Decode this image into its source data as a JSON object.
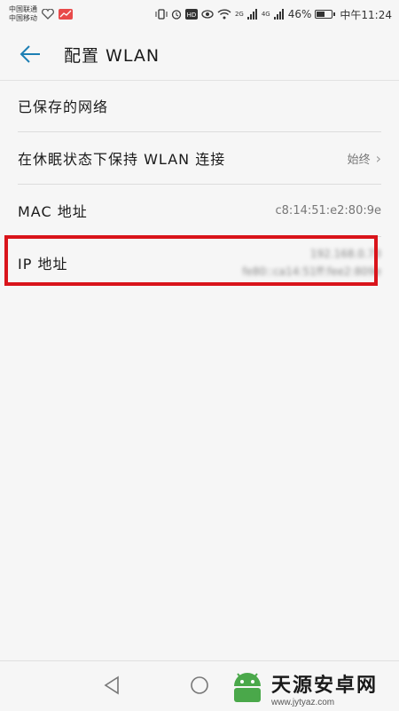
{
  "status_bar": {
    "carrier_1": "中国联通",
    "carrier_2": "中国移动",
    "network_small_1": "2G",
    "network_small_2": "4G",
    "battery": "46%",
    "time": "中午11:24"
  },
  "header": {
    "title": "配置 WLAN"
  },
  "settings": [
    {
      "label": "已保存的网络",
      "value": ""
    },
    {
      "label": "在休眠状态下保持 WLAN 连接",
      "value": "始终"
    },
    {
      "label": "MAC 地址",
      "value": "c8:14:51:e2:80:9e"
    }
  ],
  "ip_item": {
    "label": "IP 地址",
    "ipv4": "192.168.0.73",
    "ipv6": "fe80::ca14:51ff:fee2:809e"
  },
  "watermark": {
    "name": "天源安卓网",
    "url": "www.jytyaz.com"
  },
  "colors": {
    "accent": "#1d7fb4",
    "highlight": "#d9141b",
    "watermark_green": "#4aa84a"
  }
}
